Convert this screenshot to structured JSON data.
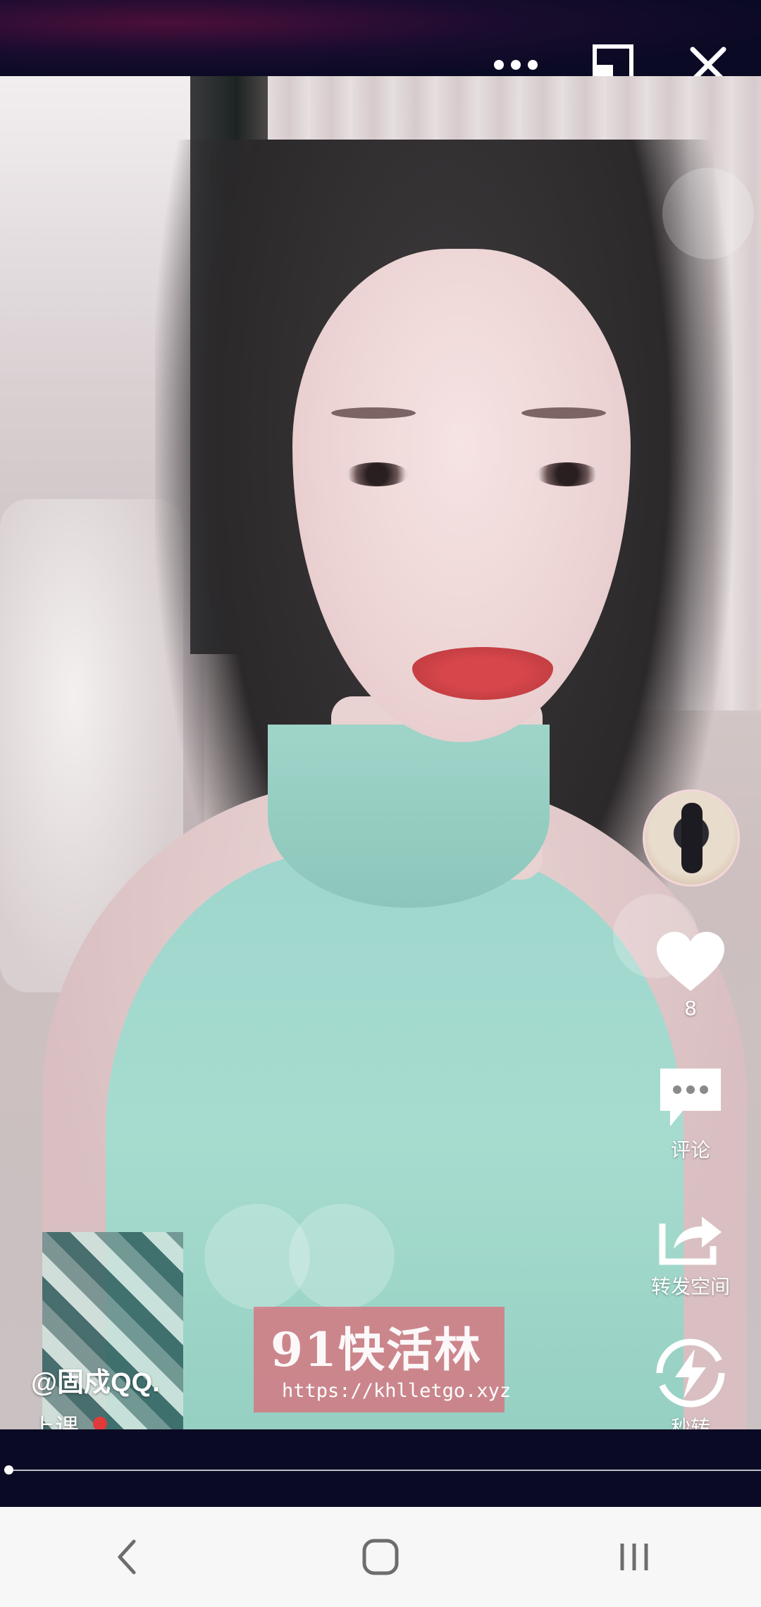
{
  "app": {
    "accent_color": "#de6876",
    "background_color": "#0b0a24"
  },
  "topbar": {
    "icons": [
      "more-icon",
      "window-mode-icon",
      "close-icon"
    ]
  },
  "side": {
    "like_count": "8",
    "comment_label": "评论",
    "share_label": "转发空间",
    "fast_label": "秒转"
  },
  "post": {
    "username": "@固戍QQ.",
    "caption": "上课"
  },
  "watermark": {
    "title": "91快活林",
    "url": "https://khlletgo.xyz"
  },
  "playback": {
    "progress_fraction": 0.005
  },
  "navbar": {
    "icons": [
      "back-icon",
      "home-icon",
      "recents-icon"
    ]
  }
}
